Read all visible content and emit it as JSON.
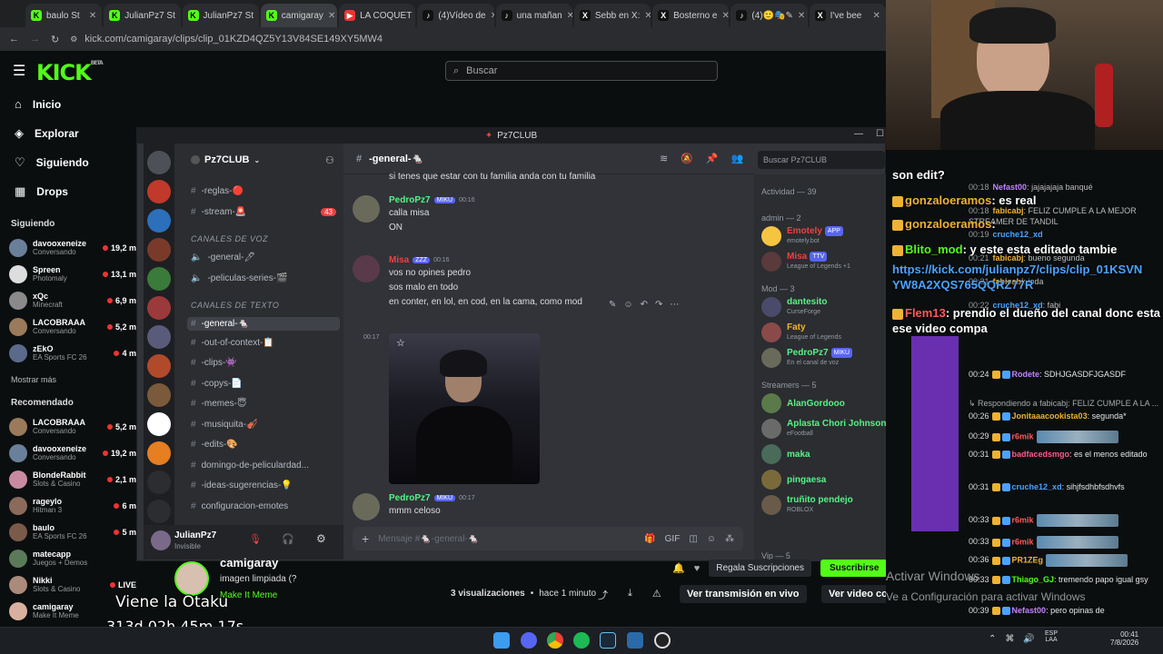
{
  "browser": {
    "tabs": [
      {
        "label": "baulo St",
        "color": "#53fc18",
        "glyph": "K"
      },
      {
        "label": "JulianPz7 St",
        "color": "#53fc18",
        "glyph": "K"
      },
      {
        "label": "JulianPz7 St",
        "color": "#53fc18",
        "glyph": "K"
      },
      {
        "label": "camigaray",
        "color": "#53fc18",
        "glyph": "K"
      },
      {
        "label": "LA COQUET",
        "color": "#e33",
        "glyph": "▶"
      },
      {
        "label": "(4)Vídeo de",
        "color": "#111",
        "glyph": "♪"
      },
      {
        "label": "una mañan",
        "color": "#111",
        "glyph": "♪"
      },
      {
        "label": "Sebb en X:",
        "color": "#111",
        "glyph": "X"
      },
      {
        "label": "Bosterno e",
        "color": "#111",
        "glyph": "X"
      },
      {
        "label": "(4)🙂🎭✎",
        "color": "#111",
        "glyph": "♪"
      },
      {
        "label": "I've bee",
        "color": "#111",
        "glyph": "X"
      }
    ],
    "url": "kick.com/camigaray/clips/clip_01KZD4QZ5Y13V84SE149XY5MW4"
  },
  "kick": {
    "logo": "KICK",
    "logo_sup": "BETA",
    "search_placeholder": "Buscar",
    "nav": [
      {
        "label": "Inicio",
        "icon": "home-icon",
        "glyph": "⌂"
      },
      {
        "label": "Explorar",
        "icon": "compass-icon",
        "glyph": "◈"
      },
      {
        "label": "Siguiendo",
        "icon": "heart-icon",
        "glyph": "♡"
      },
      {
        "label": "Drops",
        "icon": "drops-icon",
        "glyph": "▦"
      }
    ],
    "following_title": "Siguiendo",
    "following": [
      {
        "name": "davooxeneize",
        "game": "Conversando",
        "viewers": "19,2 m",
        "color": "#6a7f9a"
      },
      {
        "name": "Spreen",
        "game": "Photomaly",
        "viewers": "13,1 m",
        "color": "#ddd"
      },
      {
        "name": "xQc",
        "game": "Minecraft",
        "viewers": "6,9 m",
        "color": "#8a8a8a"
      },
      {
        "name": "LACOBRAAA",
        "game": "Conversando",
        "viewers": "5,2 m",
        "color": "#9a7a5a"
      },
      {
        "name": "zEkO",
        "game": "EA Sports FC 26",
        "viewers": "4 m",
        "color": "#5a6a8a"
      }
    ],
    "show_more": "Mostrar más",
    "recommended_title": "Recomendado",
    "recommended": [
      {
        "name": "LACOBRAAA",
        "game": "Conversando",
        "viewers": "5,2 m",
        "color": "#9a7a5a"
      },
      {
        "name": "davooxeneize",
        "game": "Conversando",
        "viewers": "19,2 m",
        "color": "#6a7f9a"
      },
      {
        "name": "BlondeRabbit",
        "game": "Slots & Casino",
        "viewers": "2,1 m",
        "color": "#c98aa0"
      },
      {
        "name": "rageylo",
        "game": "Hitman 3",
        "viewers": "6 m",
        "color": "#8a6a5a"
      },
      {
        "name": "baulo",
        "game": "EA Sports FC 26",
        "viewers": "5 m",
        "color": "#7a5a4a"
      },
      {
        "name": "matecapp",
        "game": "Juegos + Demos",
        "viewers": "",
        "color": "#5a7a5a"
      },
      {
        "name": "Nikki",
        "game": "Slots & Casino",
        "viewers": "LIVE",
        "color": "#aa8a7a"
      },
      {
        "name": "camigaray",
        "game": "Make It Meme",
        "viewers": "",
        "color": "#d8b0a0"
      }
    ],
    "clip": {
      "channel": "camigaray",
      "title": "imagen limpiada (?",
      "category": "Make It Meme",
      "views": "3 visualizaciones",
      "age": "hace 1 minuto",
      "subscribe": "Suscribirse",
      "gift": "Regala Suscripciones",
      "live_btn": "Ver transmisión en vivo",
      "full_btn": "Ver video completo"
    }
  },
  "discord": {
    "title": "Pz7CLUB",
    "server": "Pz7CLUB",
    "channel_header": "-general-🐁",
    "search_placeholder": "Buscar Pz7CLUB",
    "channels_top": [
      {
        "label": "-reglas-🔴",
        "badge": ""
      },
      {
        "label": "-stream-🚨",
        "badge": "43"
      }
    ],
    "voice_cat": "CANALES DE VOZ",
    "voice": [
      {
        "label": "-general-🖊"
      },
      {
        "label": "-peliculas-series-🎬"
      }
    ],
    "text_cat": "CANALES DE TEXTO",
    "text": [
      {
        "label": "-general-🐁",
        "active": true
      },
      {
        "label": "-out-of-context-📋"
      },
      {
        "label": "-clips-👾"
      },
      {
        "label": "-copys-📄"
      },
      {
        "label": "-memes-😇"
      },
      {
        "label": "-musiquita-🎻"
      },
      {
        "label": "-edits-🎨"
      },
      {
        "label": "domingo-de-peliculardad..."
      },
      {
        "label": "-ideas-sugerencias-💡"
      },
      {
        "label": "configuracion-emotes"
      }
    ],
    "user": {
      "name": "JulianPz7",
      "status": "Invisible"
    },
    "messages": [
      {
        "type": "cont",
        "text": "si tenes que estar con tu familia anda con tu familia"
      },
      {
        "type": "head",
        "author": "PedroPz7",
        "tag": "MIKU",
        "time": "00:16",
        "color": "#57f287",
        "lines": [
          "calla misa",
          "ON"
        ]
      },
      {
        "type": "head",
        "author": "Misa",
        "tag": "ZZZ",
        "time": "00:16",
        "color": "#f23f42",
        "lines": [
          "vos no opines pedro",
          "sos malo en todo",
          "en conter, en lol, en cod, en la cama, como mod"
        ]
      },
      {
        "type": "image",
        "time": "00:17"
      },
      {
        "type": "head",
        "author": "PedroPz7",
        "tag": "MIKU",
        "time": "00:17",
        "color": "#57f287",
        "lines": [
          "mmm celoso"
        ]
      }
    ],
    "composer_placeholder": "Mensaje #🐁-general-🐁",
    "members_activity": "Actividad — 39",
    "roles": [
      {
        "title": "admin — 2",
        "members": [
          {
            "name": "Emotely",
            "sub": "emotely.bot",
            "tag": "APP",
            "color": "#f23f42",
            "avatar": "#f5c542"
          },
          {
            "name": "Misa",
            "sub": "League of Legends +1",
            "tag": "TTV",
            "color": "#f23f42",
            "avatar": "#5a3a3a"
          }
        ]
      },
      {
        "title": "Mod — 3",
        "members": [
          {
            "name": "dantesito",
            "sub": "CurseForge",
            "tag": "",
            "color": "#57f287",
            "avatar": "#4a4a6a"
          },
          {
            "name": "Faty",
            "sub": "League of Legends",
            "tag": "",
            "color": "#f0b232",
            "avatar": "#8a4a4a"
          },
          {
            "name": "PedroPz7",
            "sub": "En el canal de voz",
            "tag": "MIKU",
            "color": "#57f287",
            "avatar": "#6a6a5a"
          }
        ]
      },
      {
        "title": "Streamers — 5",
        "members": [
          {
            "name": "AlanGordooo",
            "sub": "",
            "tag": "",
            "color": "#57f287",
            "avatar": "#5a7a4a"
          },
          {
            "name": "Aplasta Chori Johnson",
            "sub": "eFootball",
            "tag": "",
            "color": "#57f287",
            "avatar": "#6a6a6a"
          },
          {
            "name": "maka",
            "sub": "",
            "tag": "",
            "color": "#57f287",
            "avatar": "#4a6a5a"
          },
          {
            "name": "pingaesa",
            "sub": "",
            "tag": "",
            "color": "#57f287",
            "avatar": "#7a6a3a"
          },
          {
            "name": "truñito pendejo",
            "sub": "ROBLOX",
            "tag": "",
            "color": "#57f287",
            "avatar": "#6a5a4a"
          }
        ]
      }
    ],
    "vip_label": "Vip — 5"
  },
  "overlay": {
    "line1": "Viene la Otaku",
    "line2": "313d 02h 45m 17s",
    "windows1": "Activar Windows",
    "windows2": "Ve a Configuración para activar Windows"
  },
  "chat": [
    {
      "big": true,
      "user": "",
      "text": "son edit?",
      "ucolor": "#fff"
    },
    {
      "big": true,
      "user": "gonzaloeramos",
      "text": ": es real",
      "ucolor": "#f0b232"
    },
    {
      "big": true,
      "user": "gonzaloeramos",
      "text": ":",
      "ucolor": "#f0b232"
    },
    {
      "big": true,
      "user": "Blito_mod",
      "text": ": y este esta editado tambie",
      "ucolor": "#53fc18"
    },
    {
      "big": true,
      "user": "",
      "text": "https://kick.com/julianpz7/clips/clip_01KSVN YW8A2XQS765QQRZ77R",
      "ucolor": "#4aa3ff"
    },
    {
      "big": true,
      "user": "Flem13",
      "text": ": prendio el dueño del canal donc esta ese video compa",
      "ucolor": "#ff5a5a"
    },
    {
      "big": false,
      "time": "00:24",
      "user": "Rodete",
      "text": ": SDHJGASDFJGASDF",
      "ucolor": "#c084fc"
    },
    {
      "big": false,
      "time": "",
      "user": "",
      "text": "↳ Respondiendo a fabicabj: FELIZ CUMPLE A LA ...",
      "ucolor": "#aaa"
    },
    {
      "big": false,
      "time": "00:26",
      "user": "Jonitaaacookista03",
      "text": ": segunda*",
      "ucolor": "#f0b232"
    },
    {
      "big": false,
      "time": "00:29",
      "user": "r6mik",
      "text": "",
      "ucolor": "#ff5a5a"
    },
    {
      "big": false,
      "time": "00:31",
      "user": "badfacedsmgo",
      "text": ": es el menos editado",
      "ucolor": "#ff5a8a"
    },
    {
      "big": false,
      "time": "00:31",
      "user": "cruche12_xd",
      "text": ": sihjfsdhbfsdhvfs",
      "ucolor": "#4aa3ff"
    },
    {
      "big": false,
      "time": "00:33",
      "user": "r6mik",
      "text": "",
      "ucolor": "#ff5a5a"
    },
    {
      "big": false,
      "time": "00:33",
      "user": "r6mik",
      "text": "",
      "ucolor": "#ff5a5a"
    },
    {
      "big": false,
      "time": "00:36",
      "user": "PR1ZEg",
      "text": "",
      "ucolor": "#f0b232"
    },
    {
      "big": false,
      "time": "00:33",
      "user": "Thiago_GJ",
      "text": ": tremendo papo igual gsy",
      "ucolor": "#53fc18"
    },
    {
      "big": false,
      "time": "00:39",
      "user": "Nefast00",
      "text": ": pero opinas de",
      "ucolor": "#c084fc"
    }
  ],
  "chat_top": [
    {
      "time": "00:18",
      "user": "Nefast00",
      "text": ": jajajajaja banqué",
      "ucolor": "#c084fc"
    },
    {
      "time": "00:18",
      "user": "fabicabj",
      "text": ": FELIZ CUMPLE A LA MEJOR STREAMER DE TANDIL",
      "ucolor": "#f0b232"
    },
    {
      "time": "00:19",
      "user": "cruche12_xd",
      "text": "",
      "ucolor": "#4aa3ff"
    },
    {
      "time": "00:21",
      "user": "fabicabj",
      "text": ": bueno segunda",
      "ucolor": "#f0b232"
    },
    {
      "time": "00:21",
      "user": "fabicabj",
      "text": ": joda",
      "ucolor": "#f0b232"
    },
    {
      "time": "00:22",
      "user": "cruche12_xd",
      "text": ": fabi",
      "ucolor": "#4aa3ff"
    }
  ],
  "taskbar": {
    "lang": "ESP",
    "lang2": "LAA",
    "time": "00:41",
    "date": "7/8/2026"
  }
}
